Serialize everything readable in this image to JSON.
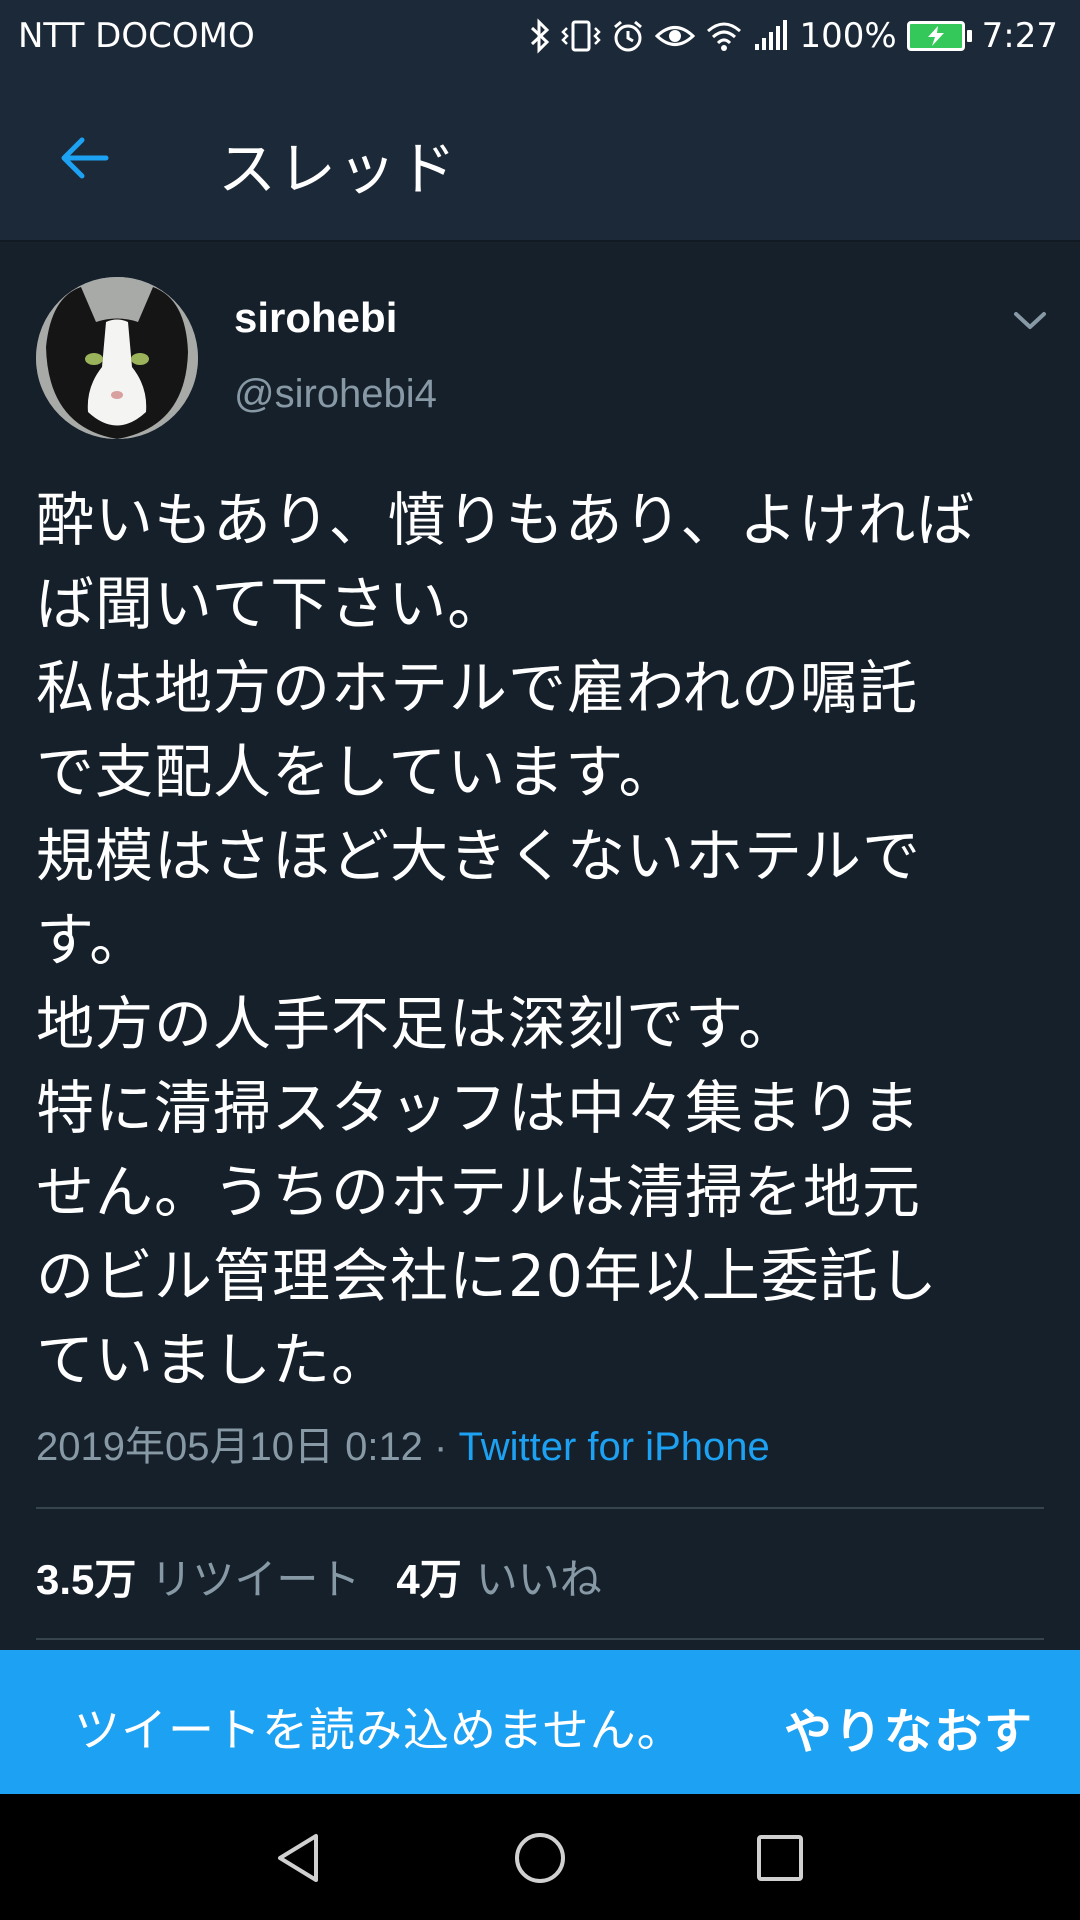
{
  "status_bar": {
    "carrier": "NTT DOCOMO",
    "battery": "100%",
    "time": "7:27",
    "icons": [
      "bluetooth-icon",
      "vibrate-icon",
      "alarm-icon",
      "eye-icon",
      "wifi-icon",
      "signal-icon",
      "battery-charging-icon"
    ],
    "battery_color": "#34c759"
  },
  "header": {
    "title": "スレッド",
    "back_icon": "back-arrow-icon",
    "accent_color": "#1da1f2"
  },
  "tweet": {
    "display_name": "sirohebi",
    "handle": "@sirohebi4",
    "menu_icon": "chevron-down-icon",
    "lines": [
      "酔いもあり、憤りもあり、よければ",
      "ば聞いて下さい。",
      "私は地方のホテルで雇われの嘱託",
      "で支配人をしています。",
      "規模はさほど大きくないホテルで",
      "す。",
      "地方の人手不足は深刻です。",
      "特に清掃スタッフは中々集まりま",
      "せん。うちのホテルは清掃を地元",
      "のビル管理会社に20年以上委託し",
      "ていました。"
    ],
    "timestamp": "2019年05月10日 0:12 · ",
    "source": "Twitter for iPhone",
    "retweets_count": "3.5万",
    "retweets_label": "リツイート",
    "likes_count": "4万",
    "likes_label": "いいね"
  },
  "banner": {
    "message": "ツイートを読み込めません。",
    "retry_label": "やりなおす",
    "background": "#1da1f2"
  },
  "nav_bar": {
    "icons": [
      "nav-back-icon",
      "nav-home-icon",
      "nav-recents-icon"
    ]
  }
}
